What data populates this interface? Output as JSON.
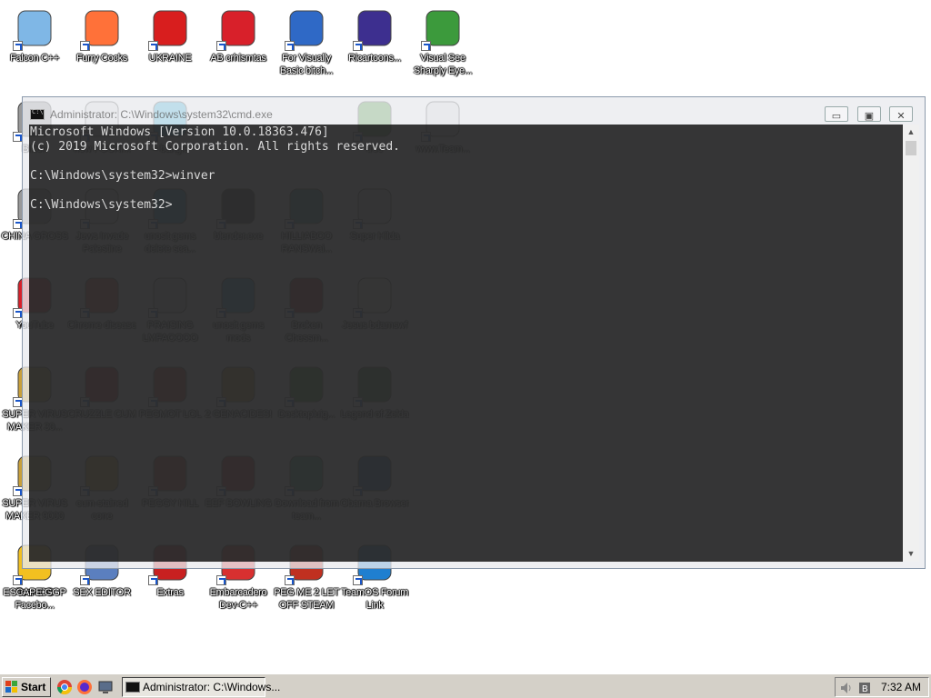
{
  "desktop": {
    "row_top": [
      {
        "label": "Falcon C++",
        "icon": "recycle-bin-icon"
      },
      {
        "label": "Furry Cocks",
        "icon": "firefox-icon"
      },
      {
        "label": "UKRAINE",
        "icon": "radiation-icon"
      },
      {
        "label": "AB crhismtas",
        "icon": "angry-bird-icon"
      },
      {
        "label": "For Visually Basic bitch...",
        "icon": "vb-icon"
      },
      {
        "label": "Ricartoons...",
        "icon": "cartoon-character-icon"
      },
      {
        "label": "Visual See Sharply Eye...",
        "icon": "csharp-icon"
      }
    ],
    "behind_window": [
      {
        "label": "Billion",
        "icon": "generic-icon"
      },
      {
        "label": "new FOCKI...",
        "icon": "document-icon"
      },
      {
        "label": "= bangle",
        "icon": "gem-icon"
      },
      {
        "label": "tree",
        "icon": "tree-icon"
      },
      {
        "label": "www.Team...",
        "icon": "document-icon"
      },
      {
        "label": "CHINA GROSS",
        "icon": "generic-icon"
      },
      {
        "label": "Jews Invade Palestine",
        "icon": "document-icon"
      },
      {
        "label": "unosit gems delete sca...",
        "icon": "gem-icon"
      },
      {
        "label": "blender.exe",
        "icon": "blender-icon"
      },
      {
        "label": "HILLIABOO RANSWai...",
        "icon": "script-icon"
      },
      {
        "label": "Super Hilda",
        "icon": "pixel-art-icon"
      },
      {
        "label": "YouTube",
        "icon": "angry-bird-icon"
      },
      {
        "label": "Chrome disease",
        "icon": "chrome-icon"
      },
      {
        "label": "PRAISING LMFAOOOO",
        "icon": "document-icon"
      },
      {
        "label": "unosit gems mods",
        "icon": "gem-icon"
      },
      {
        "label": "Broken Chessm...",
        "icon": "bomb-icon"
      },
      {
        "label": "Jesus bdamswf",
        "icon": "swf-icon"
      },
      {
        "label": "SUPER VIRUS MAKER 30...",
        "icon": "briefcase-icon"
      },
      {
        "label": "CRUZZLE CUM",
        "icon": "red-circle-icon"
      },
      {
        "label": "PEGMOT LOL",
        "icon": "peg-icon"
      },
      {
        "label": "2 GENACIDES!",
        "icon": "box-icon"
      },
      {
        "label": "Desktopluig...",
        "icon": "christmas-tree-icon"
      },
      {
        "label": "Legend of Zelda",
        "icon": "zelda-icon"
      },
      {
        "label": "SUPER VIRUS MAKER 9000",
        "icon": "briefcase-icon"
      },
      {
        "label": "cum-stained cone",
        "icon": "cone-icon"
      },
      {
        "label": "PEGGY HILL",
        "icon": "peg-icon"
      },
      {
        "label": "EEF BOWLING",
        "icon": "red-door-icon"
      },
      {
        "label": "Download from team...",
        "icon": "book-icon"
      },
      {
        "label": "Obama Browser",
        "icon": "obama-icon"
      },
      {
        "label": "TeamOS Facebo...",
        "icon": "gear-icon"
      }
    ],
    "row_bottom": [
      {
        "label": "ESCAPE GGP",
        "icon": "folder-icon"
      },
      {
        "label": "SEX EDITOR",
        "icon": "editor-icon"
      },
      {
        "label": "Extras",
        "icon": "red-door-icon"
      },
      {
        "label": "Embarcadero Dev-C++",
        "icon": "devcpp-icon"
      },
      {
        "label": "PEG ME 2 LET OFF STEAM",
        "icon": "peg-icon"
      },
      {
        "label": "TeamOS Forum Link",
        "icon": "gear-icon"
      }
    ]
  },
  "cmd_window": {
    "title": "Administrator: C:\\Windows\\system32\\cmd.exe",
    "console_text": "Microsoft Windows [Version 10.0.18363.476]\n(c) 2019 Microsoft Corporation. All rights reserved.\n\nC:\\Windows\\system32>winver\n\nC:\\Windows\\system32>",
    "minimize_glyph": "▭",
    "maximize_glyph": "▣",
    "close_glyph": "✕"
  },
  "taskbar": {
    "start_label": "Start",
    "task_button_label": "Administrator: C:\\Windows...",
    "clock": "7:32 AM",
    "tray_icons": [
      "speaker-icon",
      "network-icon"
    ],
    "quick_launch": [
      "chrome-icon",
      "firefox-icon",
      "show-desktop-icon"
    ]
  },
  "colors": {
    "accent": "#1a56c9",
    "taskbar": "#d4d0c8",
    "console_bg": "#0c0c0c"
  }
}
